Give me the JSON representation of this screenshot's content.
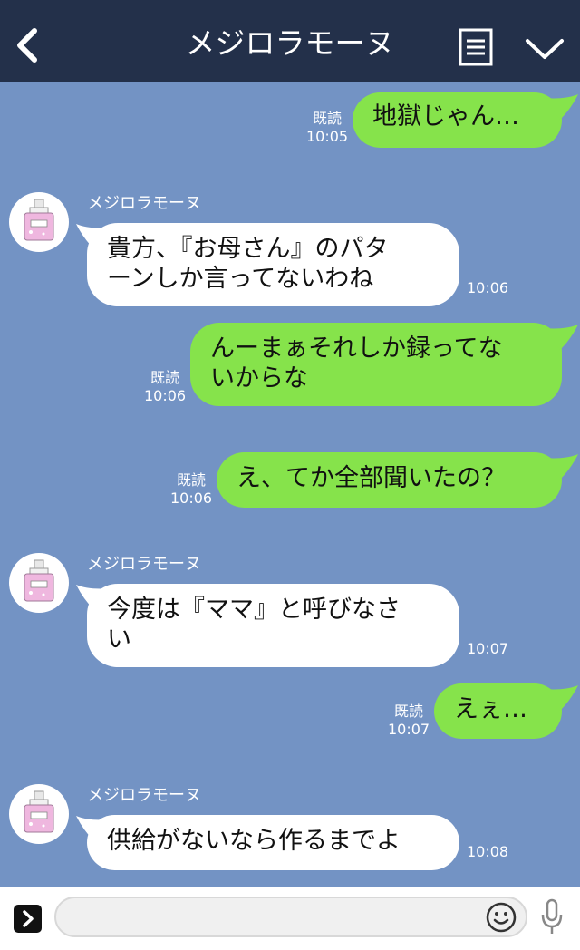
{
  "header": {
    "title": "メジロラモーヌ"
  },
  "messages": [
    {
      "side": "me",
      "text": "地獄じゃん…",
      "read": "既読",
      "time": "10:05"
    },
    {
      "side": "them",
      "sender": "メジロラモーヌ",
      "text": "貴方、『お母さん』のパタ\nーンしか言ってないわね",
      "time": "10:06"
    },
    {
      "side": "me",
      "text": "んーまぁそれしか録ってな\nいからな",
      "read": "既読",
      "time": "10:06"
    },
    {
      "side": "me",
      "text": "え、てか全部聞いたの？",
      "read": "既読",
      "time": "10:06"
    },
    {
      "side": "them",
      "sender": "メジロラモーヌ",
      "text": "今度は『ママ』と呼びなさ\nい",
      "time": "10:07"
    },
    {
      "side": "me",
      "text": "えぇ…",
      "read": "既読",
      "time": "10:07"
    },
    {
      "side": "them",
      "sender": "メジロラモーヌ",
      "text": "供給がないなら作るまでよ",
      "time": "10:08"
    }
  ],
  "footer": {
    "input_placeholder": ""
  },
  "icons": {
    "back": "back-chevron-icon",
    "menu": "menu-lines-icon",
    "collapse": "chevron-down-icon",
    "expand": "expand-chevron-icon",
    "emoji": "smiley-icon",
    "mic": "microphone-icon"
  },
  "colors": {
    "header_bg": "#23304a",
    "chat_bg": "#7393c4",
    "my_bubble": "#86e34b",
    "their_bubble": "#ffffff"
  }
}
